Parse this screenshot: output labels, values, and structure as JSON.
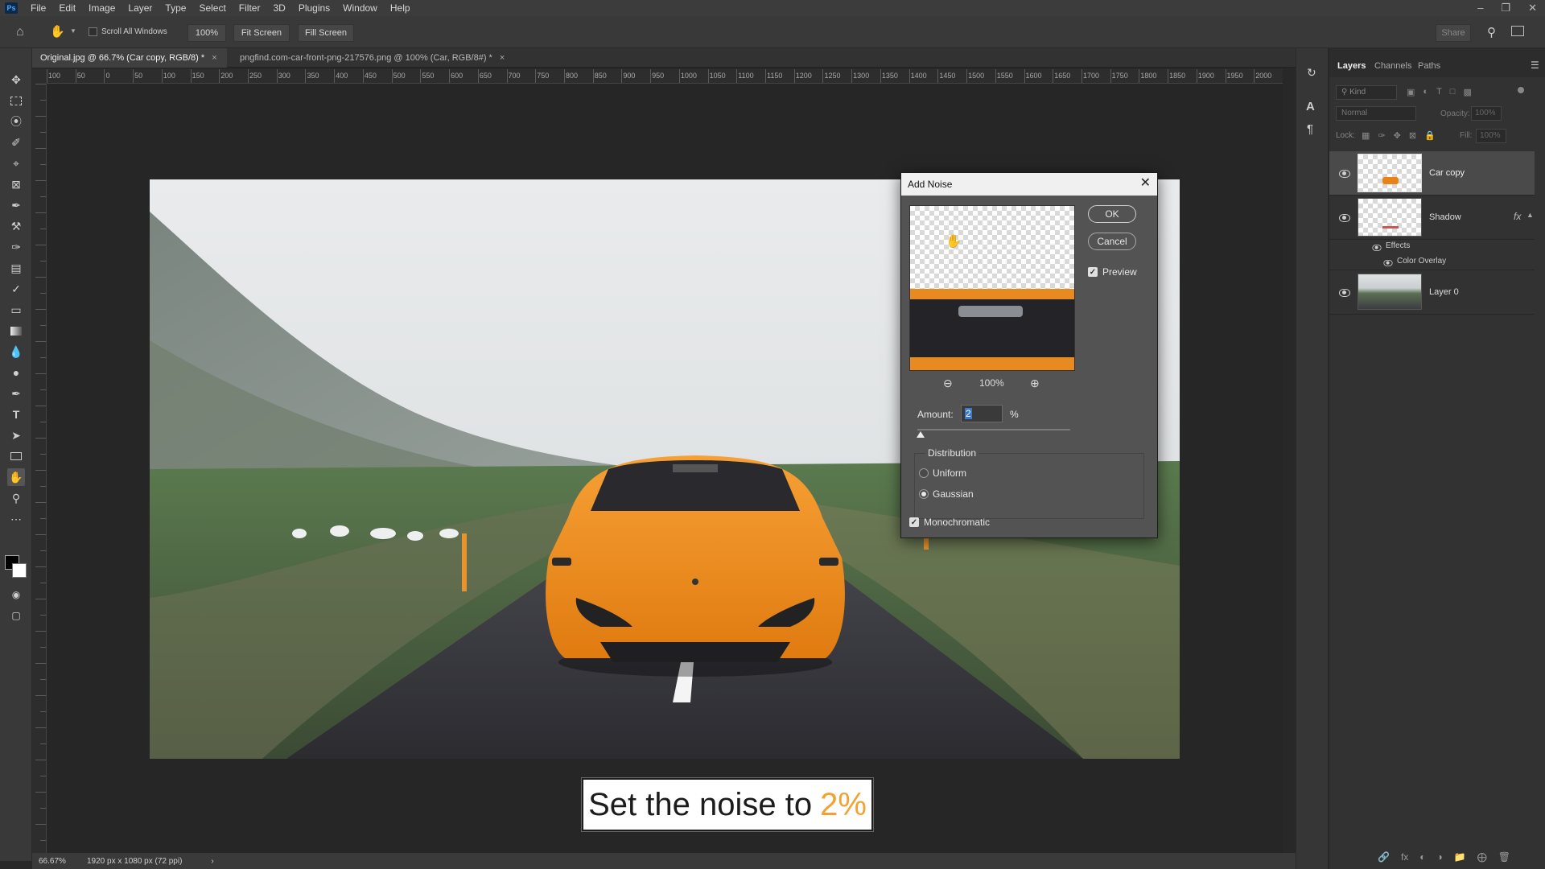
{
  "menu": [
    "File",
    "Edit",
    "Image",
    "Layer",
    "Type",
    "Select",
    "Filter",
    "3D",
    "Plugins",
    "Window",
    "Help"
  ],
  "app_logo": "Ps",
  "options": {
    "scroll_all_windows": "Scroll All Windows",
    "zoom_value": "100%",
    "fit_screen": "Fit Screen",
    "fill_screen": "Fill Screen",
    "share": "Share"
  },
  "tabs": [
    {
      "label": "Original.jpg @ 66.7% (Car copy, RGB/8) *"
    },
    {
      "label": "pngfind.com-car-front-png-217576.png @ 100% (Car, RGB/8#) *"
    }
  ],
  "ruler": {
    "h": [
      "100",
      "50",
      "0",
      "50",
      "100",
      "150",
      "200",
      "250",
      "300",
      "350",
      "400",
      "450",
      "500",
      "550",
      "600",
      "650",
      "700",
      "750",
      "800",
      "850",
      "900",
      "950",
      "1000",
      "1050",
      "1100",
      "1150",
      "1200",
      "1250",
      "1300",
      "1350",
      "1400",
      "1450",
      "1500",
      "1550",
      "1600",
      "1650",
      "1700",
      "1750",
      "1800",
      "1850",
      "1900",
      "1950",
      "2000"
    ]
  },
  "caption": {
    "text": "Set the noise to",
    "highlight": "2%"
  },
  "status": {
    "zoom": "66.67%",
    "doc": "1920 px x 1080 px (72 ppi)"
  },
  "layers_panel": {
    "tabs": [
      "Layers",
      "Channels",
      "Paths"
    ],
    "kind": "Kind",
    "blend": "Normal",
    "opacity_label": "Opacity:",
    "opacity_value": "100%",
    "lock_label": "Lock:",
    "fill_label": "Fill:",
    "fill_value": "100%",
    "layers": [
      {
        "name": "Car copy"
      },
      {
        "name": "Shadow",
        "fx": "fx",
        "effects": "Effects",
        "effect_item": "Color Overlay"
      },
      {
        "name": "Layer 0"
      }
    ]
  },
  "dialog": {
    "title": "Add Noise",
    "ok": "OK",
    "cancel": "Cancel",
    "preview": "Preview",
    "zoom": "100%",
    "amount_label": "Amount:",
    "amount_value": "2",
    "amount_unit": "%",
    "amount_slider_fraction": 0.02,
    "distribution": "Distribution",
    "uniform": "Uniform",
    "gaussian": "Gaussian",
    "selected_distribution": "Gaussian",
    "monochromatic": "Monochromatic",
    "monochromatic_checked": true,
    "preview_checked": true
  },
  "colors": {
    "accent_orange": "#f2a230",
    "car_orange": "#f08a1c"
  }
}
